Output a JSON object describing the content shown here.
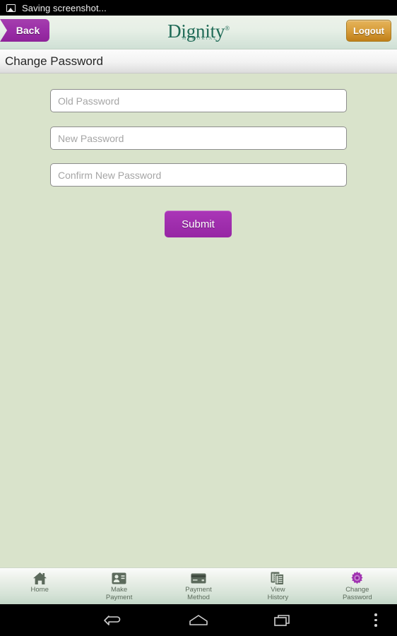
{
  "status_bar": {
    "icon": "screenshot-image-icon",
    "text": "Saving screenshot..."
  },
  "header": {
    "back_label": "Back",
    "logout_label": "Logout",
    "logo_main": "Dignity",
    "logo_registered": "®",
    "logo_sub": "MEMORIAL"
  },
  "page": {
    "title": "Change Password"
  },
  "form": {
    "fields": [
      {
        "name": "old-password",
        "placeholder": "Old Password",
        "value": ""
      },
      {
        "name": "new-password",
        "placeholder": "New Password",
        "value": ""
      },
      {
        "name": "confirm-new-password",
        "placeholder": "Confirm New Password",
        "value": ""
      }
    ],
    "submit_label": "Submit"
  },
  "tabbar": {
    "items": [
      {
        "icon": "home-icon",
        "label": "Home",
        "active": false
      },
      {
        "icon": "id-card-icon",
        "label": "Make\nPayment",
        "active": false
      },
      {
        "icon": "credit-card-icon",
        "label": "Payment\nMethod",
        "active": false
      },
      {
        "icon": "documents-icon",
        "label": "View\nHistory",
        "active": false
      },
      {
        "icon": "gear-icon",
        "label": "Change\nPassword",
        "active": true
      }
    ]
  },
  "navbar": {
    "back": "back-arrow-icon",
    "home": "home-pentagon-icon",
    "recents": "recents-icon",
    "menu": "overflow-menu-icon"
  },
  "colors": {
    "page_background": "#d9e3cb",
    "accent_purple": "#9b2fa8",
    "logout_gold": "#d9a03f",
    "logo_green": "#1f6a56",
    "active_tab_purple": "#9b2fa8"
  }
}
